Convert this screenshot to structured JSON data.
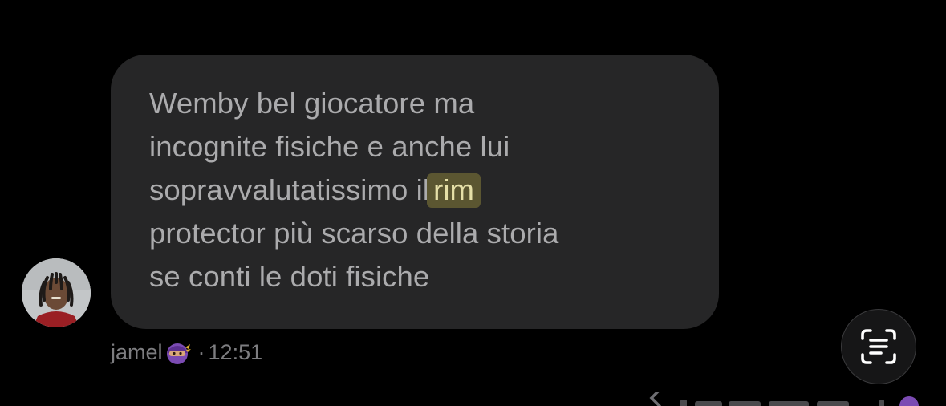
{
  "message": {
    "lines": [
      {
        "text": "Wemby bel giocatore ma",
        "before": "",
        "highlight": "",
        "after": ""
      },
      {
        "text": "incognite fisiche e anche lui",
        "before": "",
        "highlight": "",
        "after": ""
      },
      {
        "text": "",
        "before": "sopravvalutatissimo il",
        "highlight": "rim",
        "after": ""
      },
      {
        "text": "protector più scarso della storia",
        "before": "",
        "highlight": "",
        "after": ""
      },
      {
        "text": "se conti le doti fisiche",
        "before": "",
        "highlight": "",
        "after": ""
      }
    ]
  },
  "sender": {
    "name": "jamel",
    "emoji_icon": "ninja-emoji-icon",
    "separator": "·",
    "time": "12:51"
  },
  "scan_button": {
    "icon": "live-text-scan-icon"
  },
  "colors": {
    "background": "#000000",
    "bubble": "#262627",
    "message_text": "#ababad",
    "highlight_bg": "#5b5631",
    "highlight_text": "#e6e0a8",
    "meta_text": "#7d7d80"
  }
}
